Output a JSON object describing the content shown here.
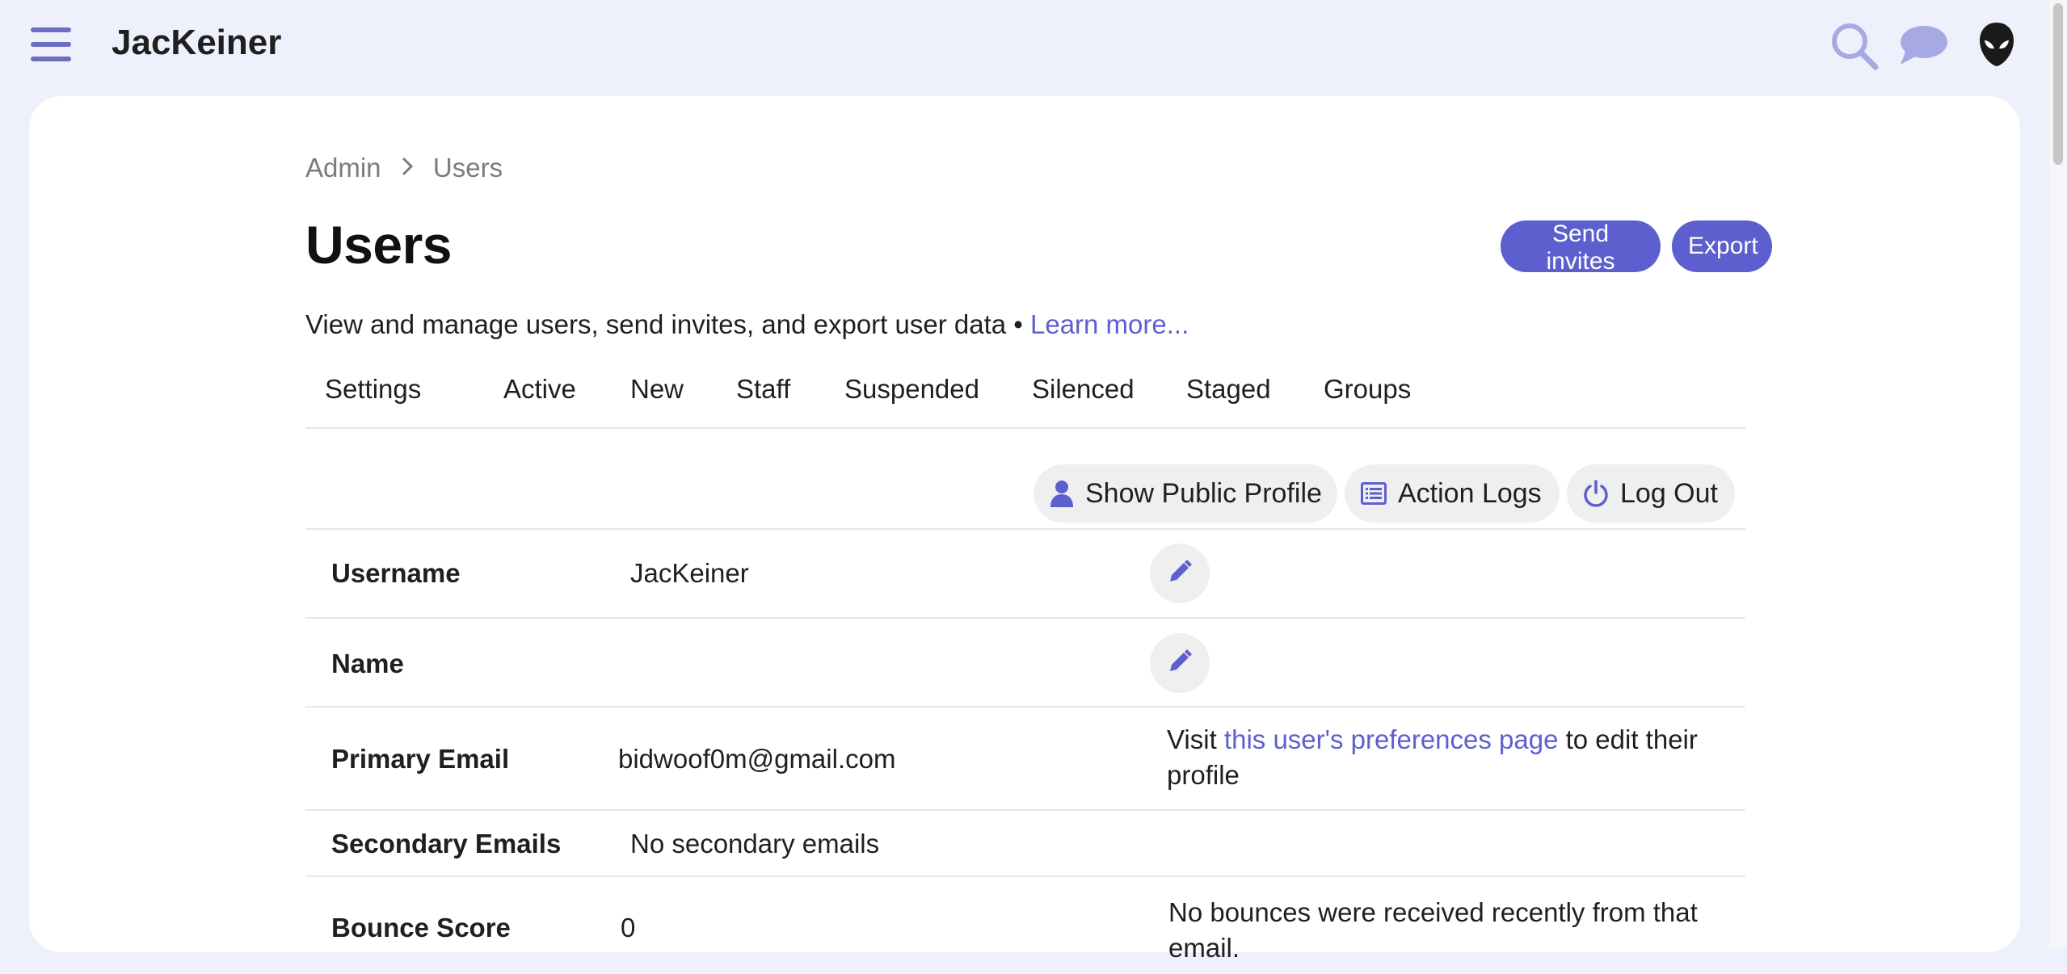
{
  "header": {
    "site_title": "JacKeiner",
    "icons": [
      "hamburger-menu-icon",
      "search-icon",
      "chat-icon",
      "avatar"
    ],
    "accent_color": "#6c6ec0"
  },
  "breadcrumb": [
    "Admin",
    "Users"
  ],
  "page": {
    "title": "Users",
    "description": "View and manage users, send invites, and export user data •",
    "learn_more": "Learn more..."
  },
  "buttons": {
    "send_invites": "Send invites",
    "export": "Export"
  },
  "tabs": [
    "Settings",
    "Active",
    "New",
    "Staff",
    "Suspended",
    "Silenced",
    "Staged",
    "Groups"
  ],
  "actions": {
    "show_public_profile": "Show Public Profile",
    "action_logs": "Action Logs",
    "log_out": "Log Out"
  },
  "user": {
    "username_label": "Username",
    "username": "JacKeiner",
    "name_label": "Name",
    "name": "",
    "primary_email_label": "Primary Email",
    "primary_email": "bidwoof0m@gmail.com",
    "primary_email_note_prefix": "Visit ",
    "primary_email_note_link": "this user's preferences page",
    "primary_email_note_suffix": " to edit their profile",
    "secondary_emails_label": "Secondary Emails",
    "secondary_emails": "No secondary emails",
    "bounce_score_label": "Bounce Score",
    "bounce_score": "0",
    "bounce_note": "No bounces were received recently from that email."
  },
  "colors": {
    "primary": "#5d5fcf",
    "background": "#eef0fb",
    "card": "#ffffff"
  }
}
